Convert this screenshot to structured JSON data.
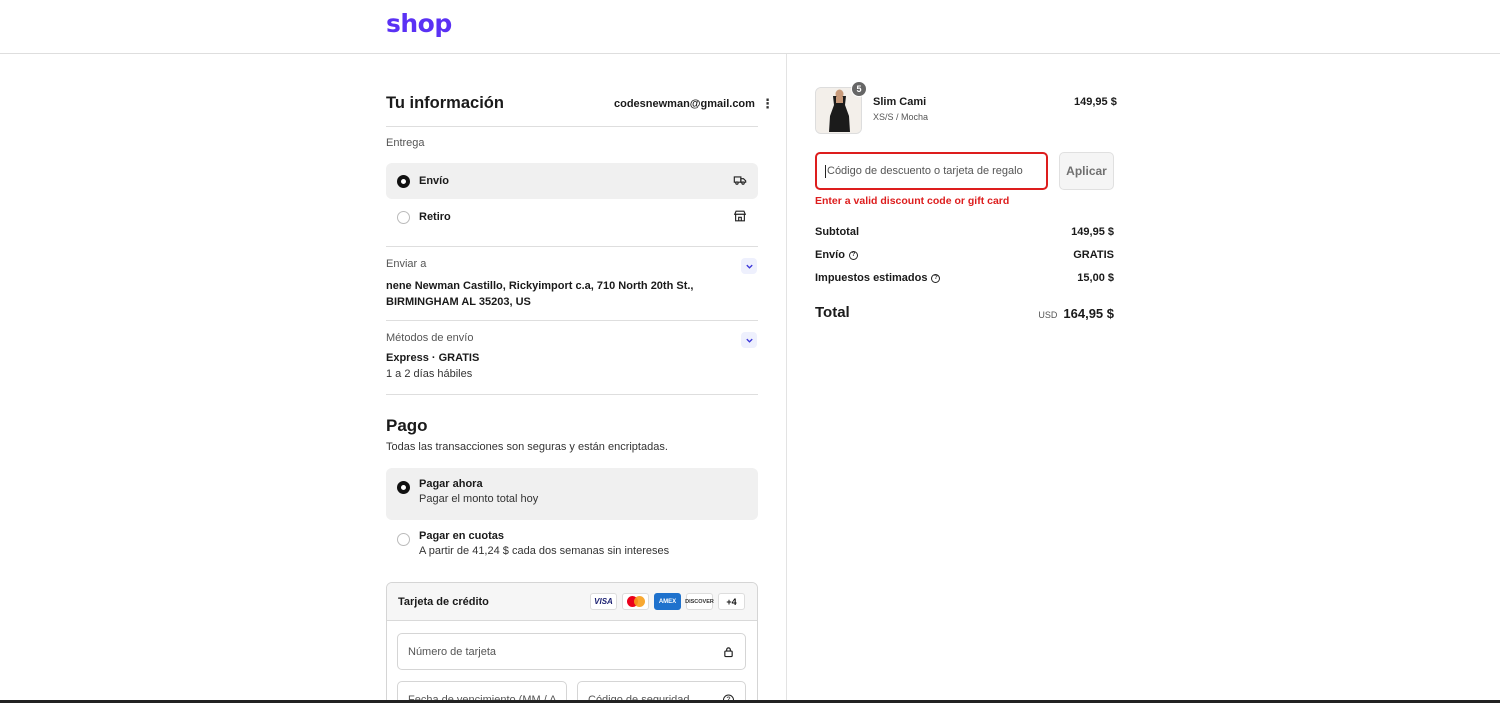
{
  "header": {
    "logo_text": "shop",
    "brand_color": "#5a31f4"
  },
  "info": {
    "title": "Tu información",
    "email": "codesnewman@gmail.com",
    "menu_icon": "kebab-icon"
  },
  "delivery": {
    "label": "Entrega",
    "options": [
      {
        "label": "Envío",
        "selected": true,
        "icon": "truck-icon"
      },
      {
        "label": "Retiro",
        "selected": false,
        "icon": "store-icon"
      }
    ]
  },
  "ship_to": {
    "label": "Enviar a",
    "address": "nene Newman Castillo, Rickyimport c.a, 710 North 20th St., BIRMINGHAM AL 35203, US"
  },
  "shipping_method": {
    "label": "Métodos de envío",
    "name": "Express · GRATIS",
    "days": "1 a 2 días hábiles"
  },
  "payment": {
    "title": "Pago",
    "subtitle": "Todas las transacciones son seguras y están encriptadas.",
    "options": [
      {
        "label": "Pagar ahora",
        "sub": "Pagar el monto total hoy",
        "selected": true
      },
      {
        "label": "Pagar en cuotas",
        "sub": "A partir de 41,24 $ cada dos semanas sin intereses",
        "selected": false
      }
    ],
    "card": {
      "title": "Tarjeta de crédito",
      "brands": [
        "VISA",
        "",
        "AMEX",
        "DISCOVER",
        "+4"
      ],
      "number_placeholder": "Número de tarjeta",
      "expiry_placeholder": "Fecha de vencimiento (MM / A...",
      "cvv_placeholder": "Código de seguridad"
    }
  },
  "order": {
    "product": {
      "name": "Slim Cami",
      "variant": "XS/S / Mocha",
      "price": "149,95 $",
      "quantity": "5"
    },
    "discount": {
      "placeholder": "Código de descuento o tarjeta de regalo",
      "apply_label": "Aplicar",
      "error": "Enter a valid discount code or gift card",
      "error_color": "#dd1d1d"
    },
    "summary": [
      {
        "label": "Subtotal",
        "value": "149,95 $",
        "help": false
      },
      {
        "label": "Envío",
        "value": "GRATIS",
        "help": true
      },
      {
        "label": "Impuestos estimados",
        "value": "15,00 $",
        "help": true
      }
    ],
    "total": {
      "label": "Total",
      "currency": "USD",
      "value": "164,95 $"
    }
  }
}
